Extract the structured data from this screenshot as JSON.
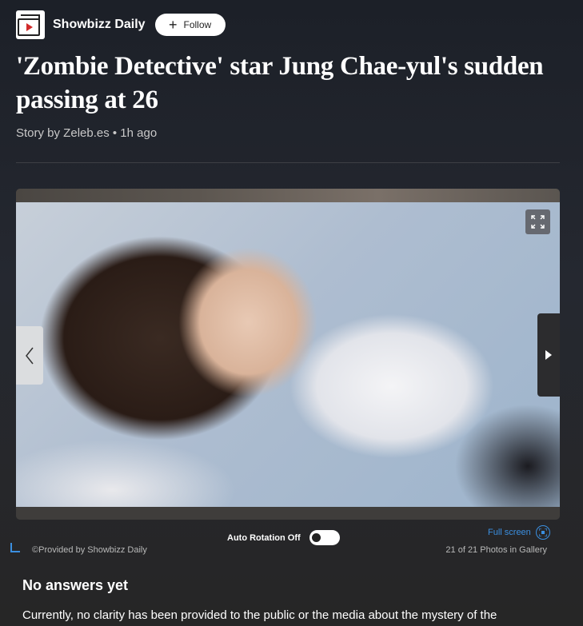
{
  "header": {
    "logo_icon": "video-play-logo-icon",
    "brand_name": "Showbizz Daily",
    "follow_label": "Follow"
  },
  "article": {
    "title": "'Zombie Detective' star Jung Chae-yul's sudden passing at 26",
    "byline": "Story by Zeleb.es • 1h ago"
  },
  "gallery": {
    "auto_rotation_label": "Auto Rotation Off",
    "full_screen_label": "Full screen",
    "credit": "©Provided by Showbizz Daily",
    "photo_count": "21 of 21 Photos in Gallery",
    "icons": [
      "expand-icon",
      "chevron-left-icon",
      "play-right-icon",
      "fullscreen-circle-icon"
    ]
  },
  "answers": {
    "heading": "No answers yet",
    "text": "Currently, no clarity has been provided to the public or the media about the mystery of the"
  },
  "colors": {
    "link": "#3b8fe0",
    "background": "#262626"
  }
}
